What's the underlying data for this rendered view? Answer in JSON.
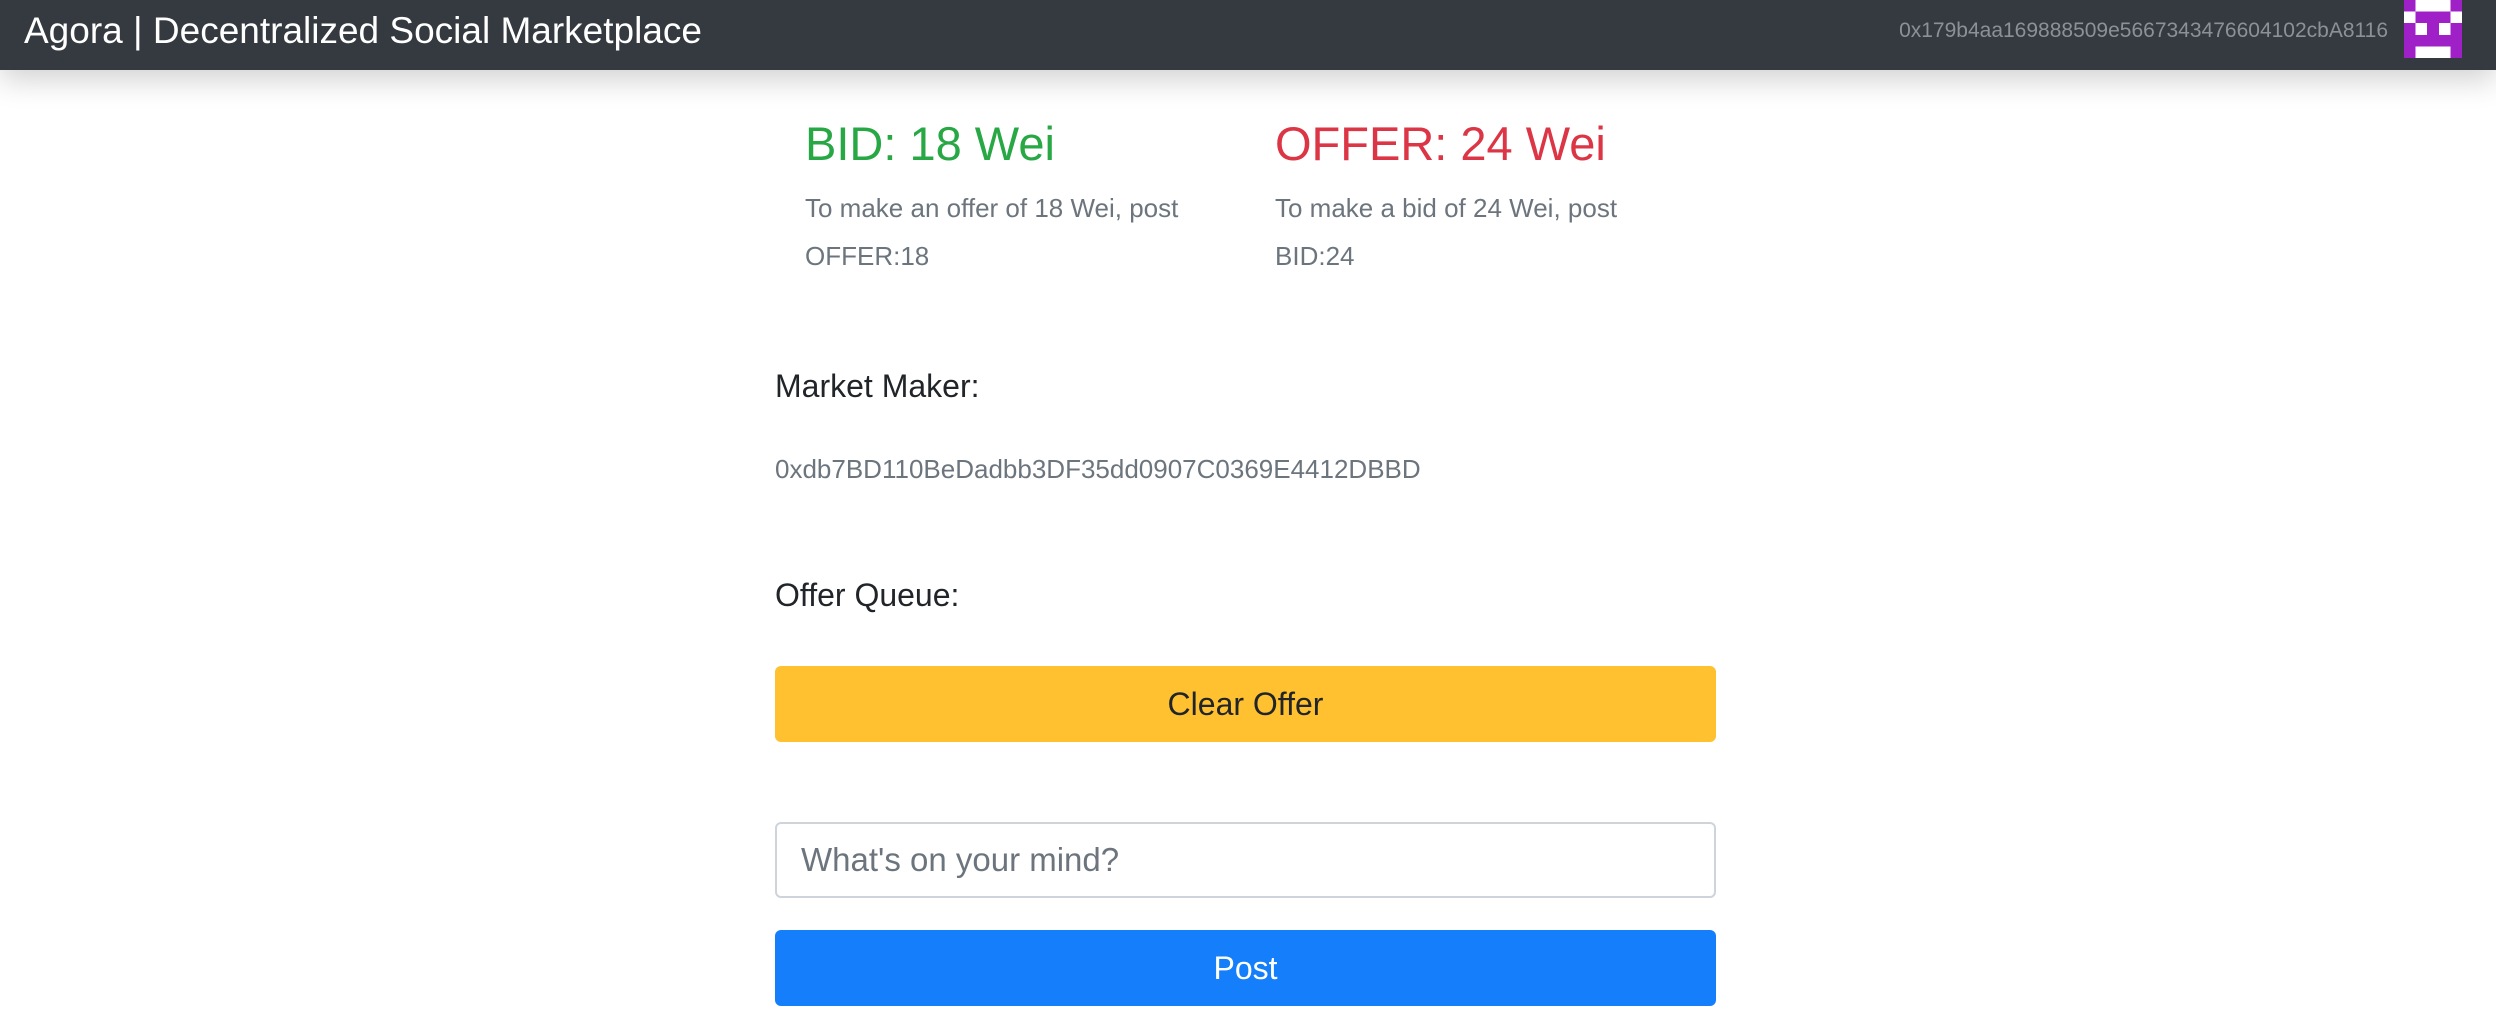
{
  "navbar": {
    "brand": "Agora | Decentralized Social Marketplace",
    "account_address": "0x179b4aa169888509e5667343476604102cbA8116",
    "avatar_icon": "identicon-avatar",
    "avatar_color": "#a020c8"
  },
  "quotes": {
    "bid_title": "BID: 18 Wei",
    "bid_hint": "To make an offer of 18 Wei, post OFFER:18",
    "offer_title": "OFFER: 24 Wei",
    "offer_hint": "To make a bid of 24 Wei, post BID:24",
    "bid_color": "#28a745",
    "offer_color": "#dc3545"
  },
  "market_maker": {
    "label": "Market Maker:",
    "address": "0xdb7BD110BeDadbb3DF35dd0907C0369E4412DBBD"
  },
  "offer_queue": {
    "label": "Offer Queue:",
    "clear_button": "Clear Offer"
  },
  "composer": {
    "value": "",
    "placeholder": "What's on your mind?",
    "post_button": "Post"
  }
}
